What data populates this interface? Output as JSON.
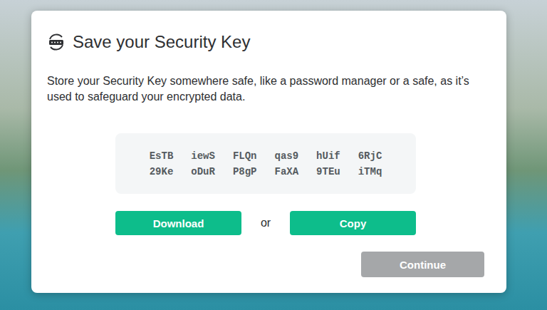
{
  "dialog": {
    "title": "Save your Security Key",
    "description": "Store your Security Key somewhere safe, like a password manager or a safe, as it’s used to safeguard your encrypted data.",
    "key_rows": [
      [
        "EsTB",
        "iewS",
        "FLQn",
        "qas9",
        "hUif",
        "6RjC"
      ],
      [
        "29Ke",
        "oDuR",
        "P8gP",
        "FaXA",
        "9TEu",
        "iTMq"
      ]
    ],
    "buttons": [
      {
        "label": "Download"
      },
      {
        "label": "Copy"
      }
    ],
    "separator": "or",
    "continue": {
      "label": "Continue",
      "disabled": true
    }
  }
}
